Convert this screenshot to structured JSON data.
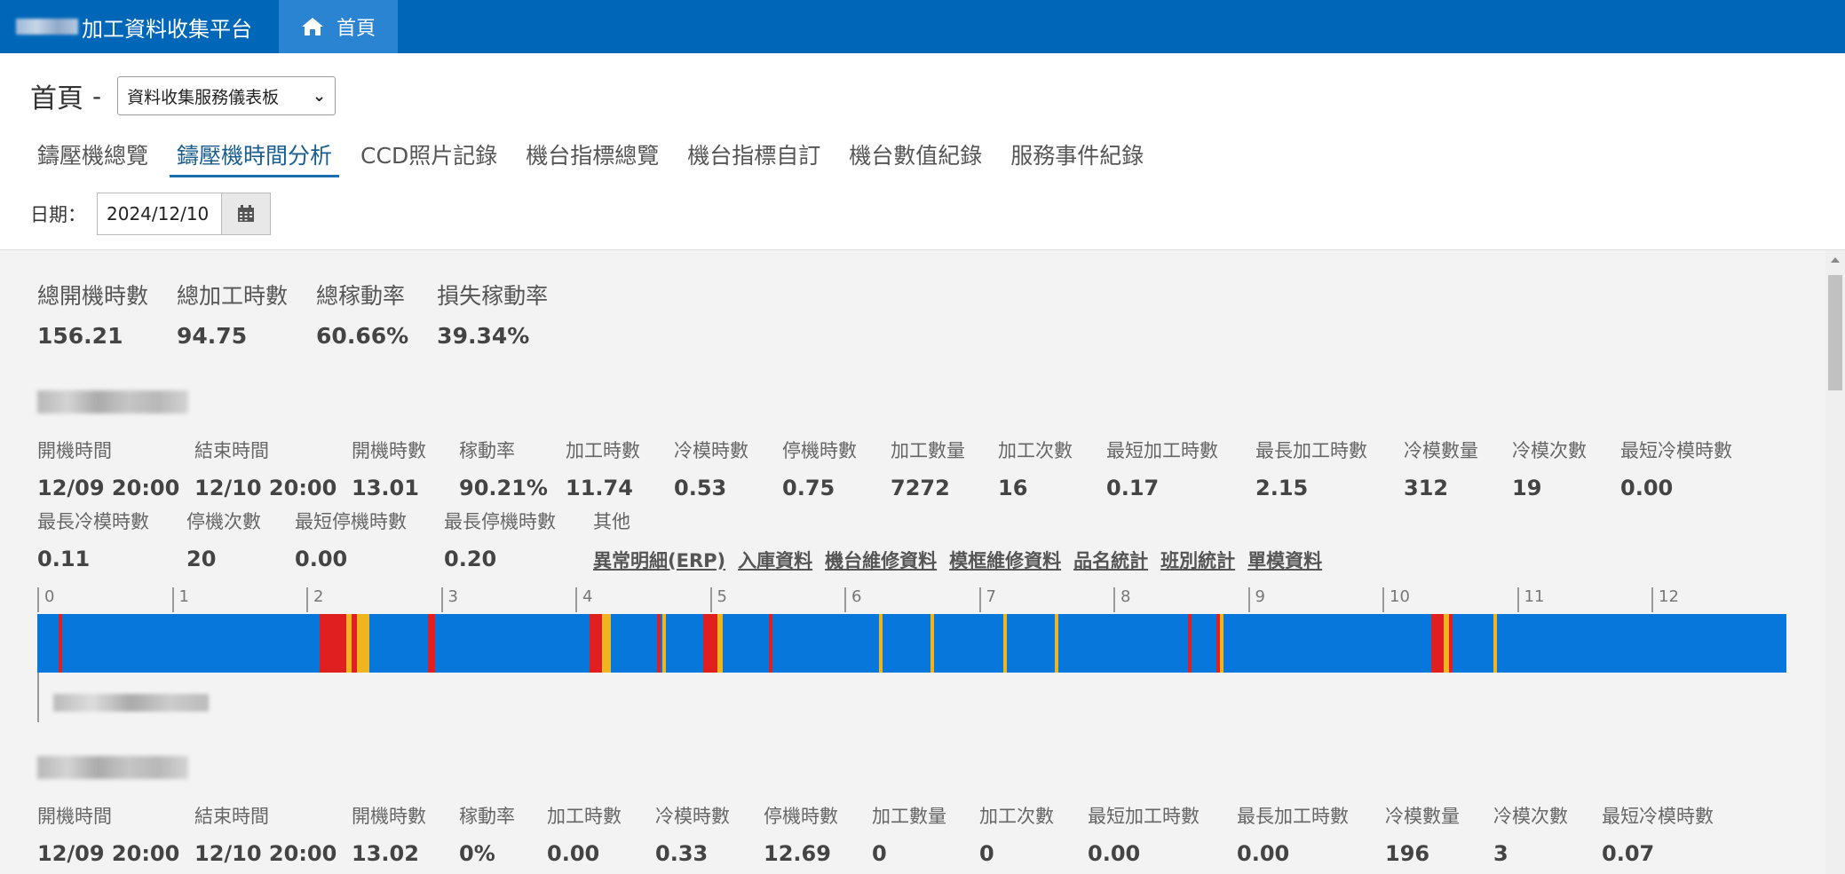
{
  "app": {
    "brand_suffix": "加工資料收集平台",
    "home_tab": "首頁"
  },
  "header": {
    "title": "首頁",
    "dash": "-",
    "dashboard_select": "資料收集服務儀表板",
    "tabs": [
      "鑄壓機總覽",
      "鑄壓機時間分析",
      "CCD照片記錄",
      "機台指標總覽",
      "機台指標自訂",
      "機台數值紀錄",
      "服務事件紀錄"
    ],
    "active_tab": 1,
    "date_label": "日期：",
    "date_value": "2024/12/10"
  },
  "summary": [
    {
      "label": "總開機時數",
      "value": "156.21"
    },
    {
      "label": "總加工時數",
      "value": "94.75"
    },
    {
      "label": "總稼動率",
      "value": "60.66%"
    },
    {
      "label": "損失稼動率",
      "value": "39.34%"
    }
  ],
  "machines": [
    {
      "row1": [
        {
          "k": "開機時間",
          "v": "12/09 20:00"
        },
        {
          "k": "結束時間",
          "v": "12/10 20:00"
        },
        {
          "k": "開機時數",
          "v": "13.01"
        },
        {
          "k": "稼動率",
          "v": "90.21%"
        },
        {
          "k": "加工時數",
          "v": "11.74"
        },
        {
          "k": "冷模時數",
          "v": "0.53"
        },
        {
          "k": "停機時數",
          "v": "0.75"
        },
        {
          "k": "加工數量",
          "v": "7272"
        },
        {
          "k": "加工次數",
          "v": "16"
        },
        {
          "k": "最短加工時數",
          "v": "0.17"
        },
        {
          "k": "最長加工時數",
          "v": "2.15"
        },
        {
          "k": "冷模數量",
          "v": "312"
        },
        {
          "k": "冷模次數",
          "v": "19"
        },
        {
          "k": "最短冷模時數",
          "v": "0.00"
        }
      ],
      "row2": [
        {
          "k": "最長冷模時數",
          "v": "0.11"
        },
        {
          "k": "停機次數",
          "v": "20"
        },
        {
          "k": "最短停機時數",
          "v": "0.00"
        },
        {
          "k": "最長停機時數",
          "v": "0.20"
        }
      ],
      "other_label": "其他",
      "links": [
        "異常明細(ERP)",
        "入庫資料",
        "機台維修資料",
        "模框維修資料",
        "品名統計",
        "班別統計",
        "單模資料"
      ],
      "timeline_ticks": [
        "0",
        "1",
        "2",
        "3",
        "4",
        "5",
        "6",
        "7",
        "8",
        "9",
        "10",
        "11",
        "12"
      ],
      "timeline_colors": {
        "run": "#0877db",
        "stop": "#e02020",
        "cold": "#f0b41e"
      }
    },
    {
      "row1": [
        {
          "k": "開機時間",
          "v": "12/09 20:00"
        },
        {
          "k": "結束時間",
          "v": "12/10 20:00"
        },
        {
          "k": "開機時數",
          "v": "13.02"
        },
        {
          "k": "稼動率",
          "v": "0%"
        },
        {
          "k": "加工時數",
          "v": "0.00"
        },
        {
          "k": "冷模時數",
          "v": "0.33"
        },
        {
          "k": "停機時數",
          "v": "12.69"
        },
        {
          "k": "加工數量",
          "v": "0"
        },
        {
          "k": "加工次數",
          "v": "0"
        },
        {
          "k": "最短加工時數",
          "v": "0.00"
        },
        {
          "k": "最長加工時數",
          "v": "0.00"
        },
        {
          "k": "冷模數量",
          "v": "196"
        },
        {
          "k": "冷模次數",
          "v": "3"
        },
        {
          "k": "最短冷模時數",
          "v": "0.07"
        }
      ]
    }
  ]
}
